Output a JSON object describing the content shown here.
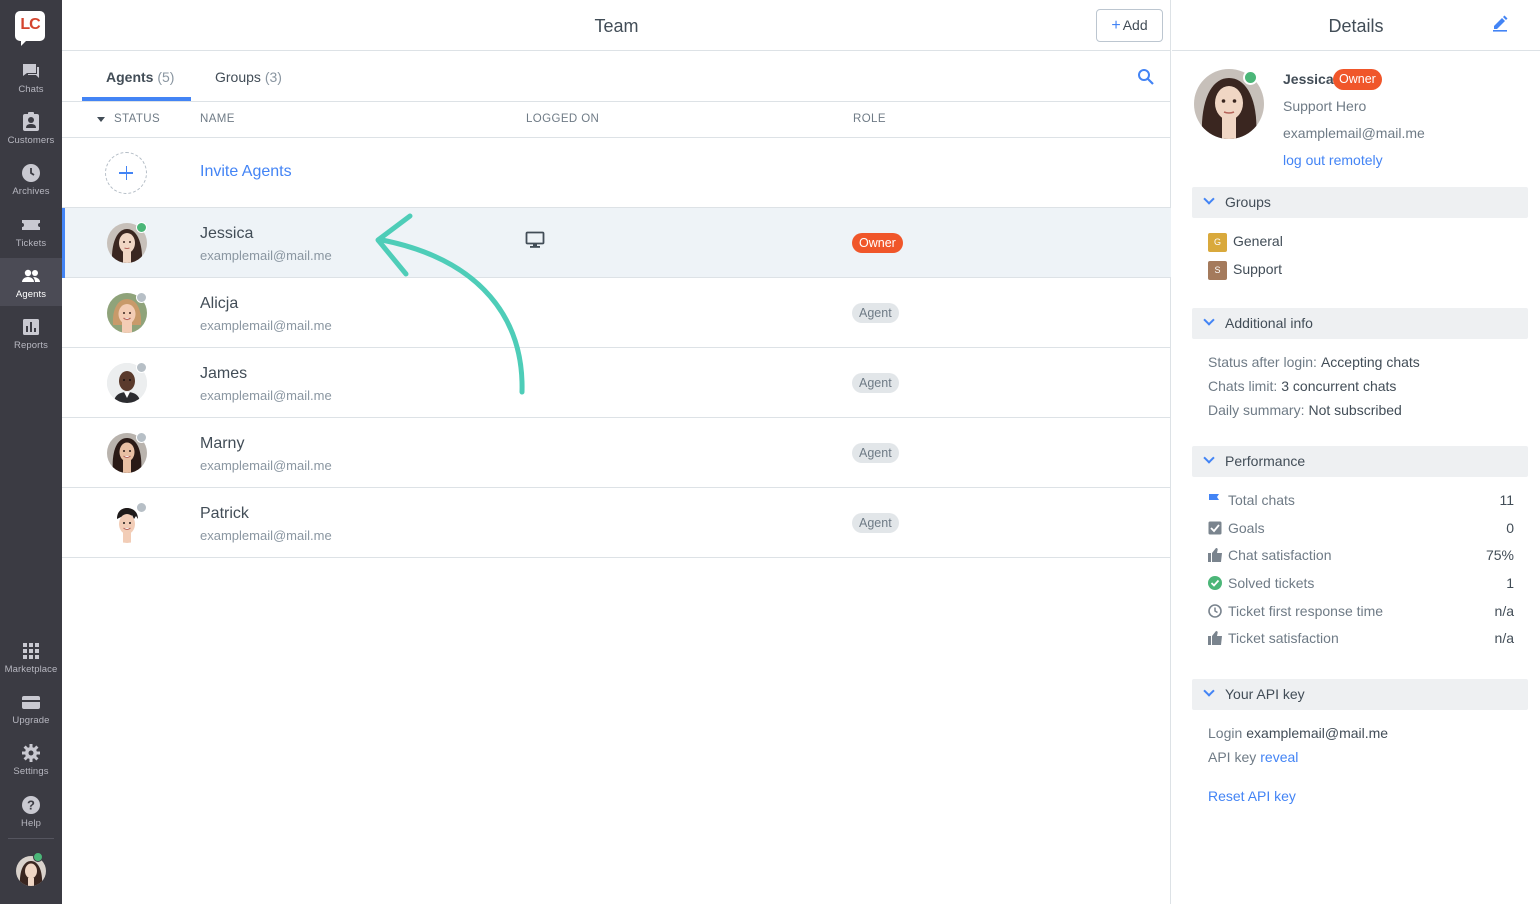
{
  "sidebar": {
    "logo": "LC",
    "items": [
      {
        "label": "Chats",
        "icon": "chat-bubble-icon"
      },
      {
        "label": "Customers",
        "icon": "customers-icon"
      },
      {
        "label": "Archives",
        "icon": "clock-icon"
      },
      {
        "label": "Tickets",
        "icon": "ticket-icon"
      },
      {
        "label": "Agents",
        "icon": "agents-icon",
        "active": true
      },
      {
        "label": "Reports",
        "icon": "bar-chart-icon"
      }
    ],
    "bottom_items": [
      {
        "label": "Marketplace",
        "icon": "grid-icon"
      },
      {
        "label": "Upgrade",
        "icon": "card-icon"
      },
      {
        "label": "Settings",
        "icon": "gear-icon"
      },
      {
        "label": "Help",
        "icon": "help-icon"
      }
    ]
  },
  "header": {
    "title": "Team",
    "add_label": "Add"
  },
  "tabs": [
    {
      "label": "Agents",
      "count": "(5)",
      "active": true
    },
    {
      "label": "Groups",
      "count": "(3)",
      "active": false
    }
  ],
  "table": {
    "columns": [
      "STATUS",
      "NAME",
      "LOGGED ON",
      "ROLE"
    ],
    "invite_label": "Invite Agents",
    "rows": [
      {
        "name": "Jessica",
        "email": "examplemail@mail.me",
        "status": "online",
        "logged_on": "monitor-icon",
        "role": "Owner"
      },
      {
        "name": "Alicja",
        "email": "examplemail@mail.me",
        "status": "offline",
        "logged_on": "",
        "role": "Agent"
      },
      {
        "name": "James",
        "email": "examplemail@mail.me",
        "status": "offline",
        "logged_on": "",
        "role": "Agent"
      },
      {
        "name": "Marny",
        "email": "examplemail@mail.me",
        "status": "offline",
        "logged_on": "",
        "role": "Agent"
      },
      {
        "name": "Patrick",
        "email": "examplemail@mail.me",
        "status": "offline",
        "logged_on": "",
        "role": "Agent"
      }
    ]
  },
  "details": {
    "title": "Details",
    "name": "Jessica",
    "badge": "Owner",
    "job_title": "Support Hero",
    "email": "examplemail@mail.me",
    "logout_link": "log out remotely",
    "groups_section": {
      "title": "Groups",
      "items": [
        {
          "initial": "G",
          "label": "General",
          "color": "#d9a93c"
        },
        {
          "initial": "S",
          "label": "Support",
          "color": "#a47a5c"
        }
      ]
    },
    "additional_section": {
      "title": "Additional info",
      "items": [
        {
          "key": "Status after login:",
          "value": "Accepting chats"
        },
        {
          "key": "Chats limit:",
          "value": "3 concurrent chats"
        },
        {
          "key": "Daily summary:",
          "value": "Not subscribed"
        }
      ]
    },
    "performance_section": {
      "title": "Performance",
      "items": [
        {
          "label": "Total chats",
          "value": "11",
          "icon": "flag-icon"
        },
        {
          "label": "Goals",
          "value": "0",
          "icon": "checkbox-icon"
        },
        {
          "label": "Chat satisfaction",
          "value": "75%",
          "icon": "thumbs-up-icon"
        },
        {
          "label": "Solved tickets",
          "value": "1",
          "icon": "check-circle-icon"
        },
        {
          "label": "Ticket first response time",
          "value": "n/a",
          "icon": "clock-icon"
        },
        {
          "label": "Ticket satisfaction",
          "value": "n/a",
          "icon": "thumbs-up-icon"
        }
      ]
    },
    "api_section": {
      "title": "Your API key",
      "login_label": "Login",
      "login_value": "examplemail@mail.me",
      "key_label": "API key",
      "reveal_link": "reveal",
      "reset_link": "Reset API key"
    }
  },
  "colors": {
    "accent": "#4384f5",
    "owner_badge": "#f0562a",
    "online": "#4bb678",
    "annotation_arrow": "#4ecdb8",
    "sidebar_bg": "#3b3b43"
  }
}
